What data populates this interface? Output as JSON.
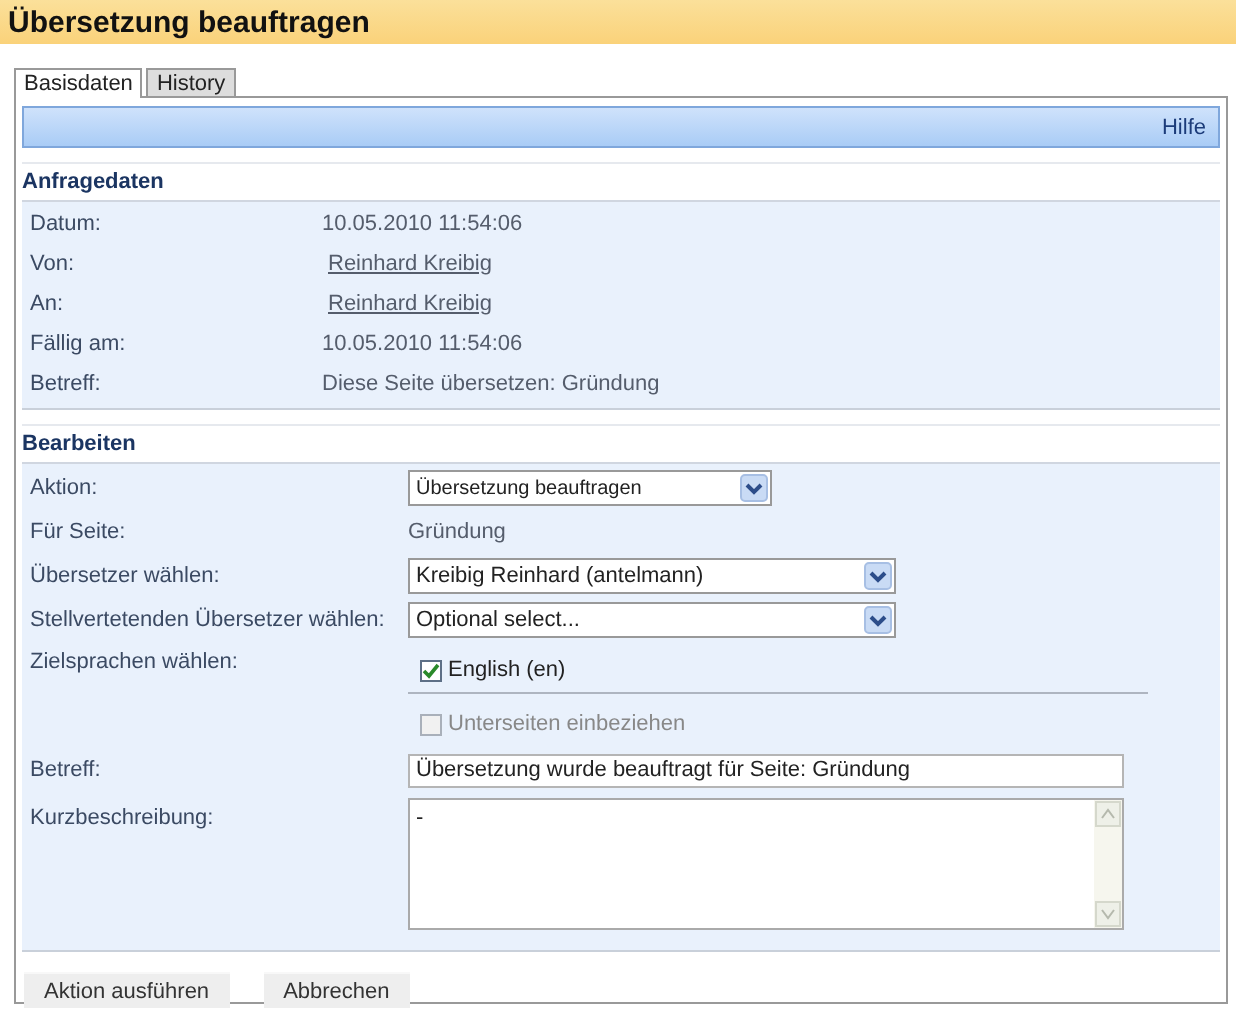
{
  "window": {
    "title": "Übersetzung beauftragen"
  },
  "tabs": [
    {
      "label": "Basisdaten",
      "selected": true
    },
    {
      "label": "History",
      "selected": false
    }
  ],
  "help_link": "Hilfe",
  "request_data": {
    "heading": "Anfragedaten",
    "rows": [
      {
        "label": "Datum:",
        "value": "10.05.2010 11:54:06",
        "kind": "text"
      },
      {
        "label": "Von:",
        "value": "Reinhard Kreibig",
        "kind": "link"
      },
      {
        "label": "An:",
        "value": "Reinhard Kreibig",
        "kind": "link"
      },
      {
        "label": "Fällig am:",
        "value": "10.05.2010 11:54:06",
        "kind": "text"
      },
      {
        "label": "Betreff:",
        "value": "Diese Seite übersetzen: Gründung",
        "kind": "text"
      }
    ]
  },
  "edit": {
    "heading": "Bearbeiten",
    "fields": [
      {
        "label": "Aktion:",
        "kind": "select",
        "value": "Übersetzung beauftragen"
      },
      {
        "label": "Für Seite:",
        "kind": "text",
        "value": "Gründung"
      },
      {
        "label": "Übersetzer wählen:",
        "kind": "select",
        "value": "Kreibig Reinhard (antelmann)"
      },
      {
        "label": "Stellvertetenden Übersetzer wählen:",
        "kind": "select",
        "value": "Optional select..."
      },
      {
        "label": "Zielsprachen wählen:",
        "kind": "checkboxes",
        "options": [
          {
            "label": "English (en)",
            "checked": true,
            "disabled": false
          },
          {
            "label": "Unterseiten einbeziehen",
            "checked": false,
            "disabled": true
          }
        ]
      },
      {
        "label": "Betreff:",
        "kind": "input",
        "value": "Übersetzung wurde beauftragt für Seite:  Gründung"
      },
      {
        "label": "Kurzbeschreibung:",
        "kind": "textarea",
        "value": "-"
      }
    ]
  },
  "buttons": [
    "Aktion ausführen",
    "Abbrechen"
  ]
}
